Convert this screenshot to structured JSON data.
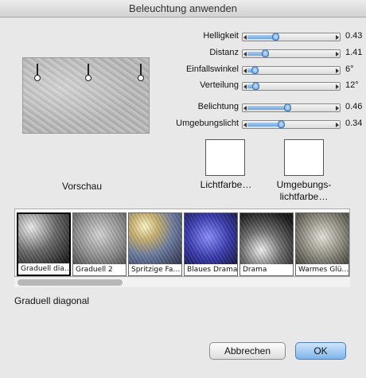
{
  "window": {
    "title": "Beleuchtung anwenden"
  },
  "sliders": [
    {
      "label": "Helligkeit",
      "value": "0.43",
      "fraction": 0.28
    },
    {
      "label": "Distanz",
      "value": "1.41",
      "fraction": 0.16
    },
    {
      "label": "Einfallswinkel",
      "value": "6°",
      "fraction": 0.04
    },
    {
      "label": "Verteilung",
      "value": "12°",
      "fraction": 0.05
    },
    {
      "label": "Belichtung",
      "value": "0.46",
      "fraction": 0.42
    },
    {
      "label": "Umgebungslicht",
      "value": "0.34",
      "fraction": 0.35
    }
  ],
  "preview": {
    "label": "Vorschau"
  },
  "swatches": {
    "light_color": {
      "label": "Lichtfarbe…",
      "color": "#ffffff"
    },
    "ambient_color": {
      "label": "Umgebungs-\nlichtfarbe…",
      "color": "#ffffff"
    }
  },
  "presets": [
    {
      "name": "Graduell dia…",
      "selected": true,
      "style": "diag"
    },
    {
      "name": "Graduell 2",
      "selected": false,
      "style": "grey"
    },
    {
      "name": "Spritzige Fa…",
      "selected": false,
      "style": "color"
    },
    {
      "name": "Blaues Drama",
      "selected": false,
      "style": "blue"
    },
    {
      "name": "Drama",
      "selected": false,
      "style": "drama"
    },
    {
      "name": "Warmes Glü…",
      "selected": false,
      "style": "warm"
    }
  ],
  "selected_preset_name": "Graduell diagonal",
  "buttons": {
    "cancel": "Abbrechen",
    "ok": "OK"
  },
  "colors": {
    "accent": "#7fb4ea",
    "slider_fill": "#6ea6e0"
  }
}
